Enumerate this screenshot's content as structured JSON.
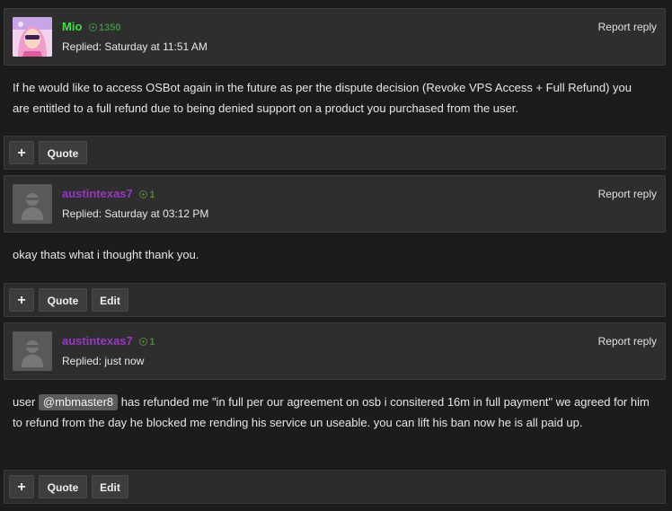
{
  "colors": {
    "mio": "#3ee03e",
    "mio_rep": "#3b8f3b",
    "member": "#9b34c9",
    "member_rep": "#4c8c2f"
  },
  "posts": [
    {
      "username": "Mio",
      "reputation": "1350",
      "replied": "Replied: Saturday at 11:51 AM",
      "report": "Report reply",
      "body": "If he would like to access OSBot again in the future as per the dispute decision (Revoke VPS Access + Full Refund) you are entitled to a full refund due to being denied support on a product you purchased from the user.",
      "buttons": {
        "plus": "+",
        "quote": "Quote"
      }
    },
    {
      "username": "austintexas7",
      "reputation": "1",
      "replied": "Replied: Saturday at 03:12 PM",
      "report": "Report reply",
      "body": "okay thats what i thought thank you.",
      "buttons": {
        "plus": "+",
        "quote": "Quote",
        "edit": "Edit"
      }
    },
    {
      "username": "austintexas7",
      "reputation": "1",
      "replied": "Replied: just now",
      "report": "Report reply",
      "body_prefix": "user",
      "mention": "@mbmaster8",
      "body_suffix": "has refunded me \"in full per our agreement on osb i consitered 16m in full payment\" we agreed for him to refund from the day he blocked me rending his service un useable. you can lift his ban now he is all paid up.",
      "buttons": {
        "plus": "+",
        "quote": "Quote",
        "edit": "Edit"
      }
    }
  ]
}
